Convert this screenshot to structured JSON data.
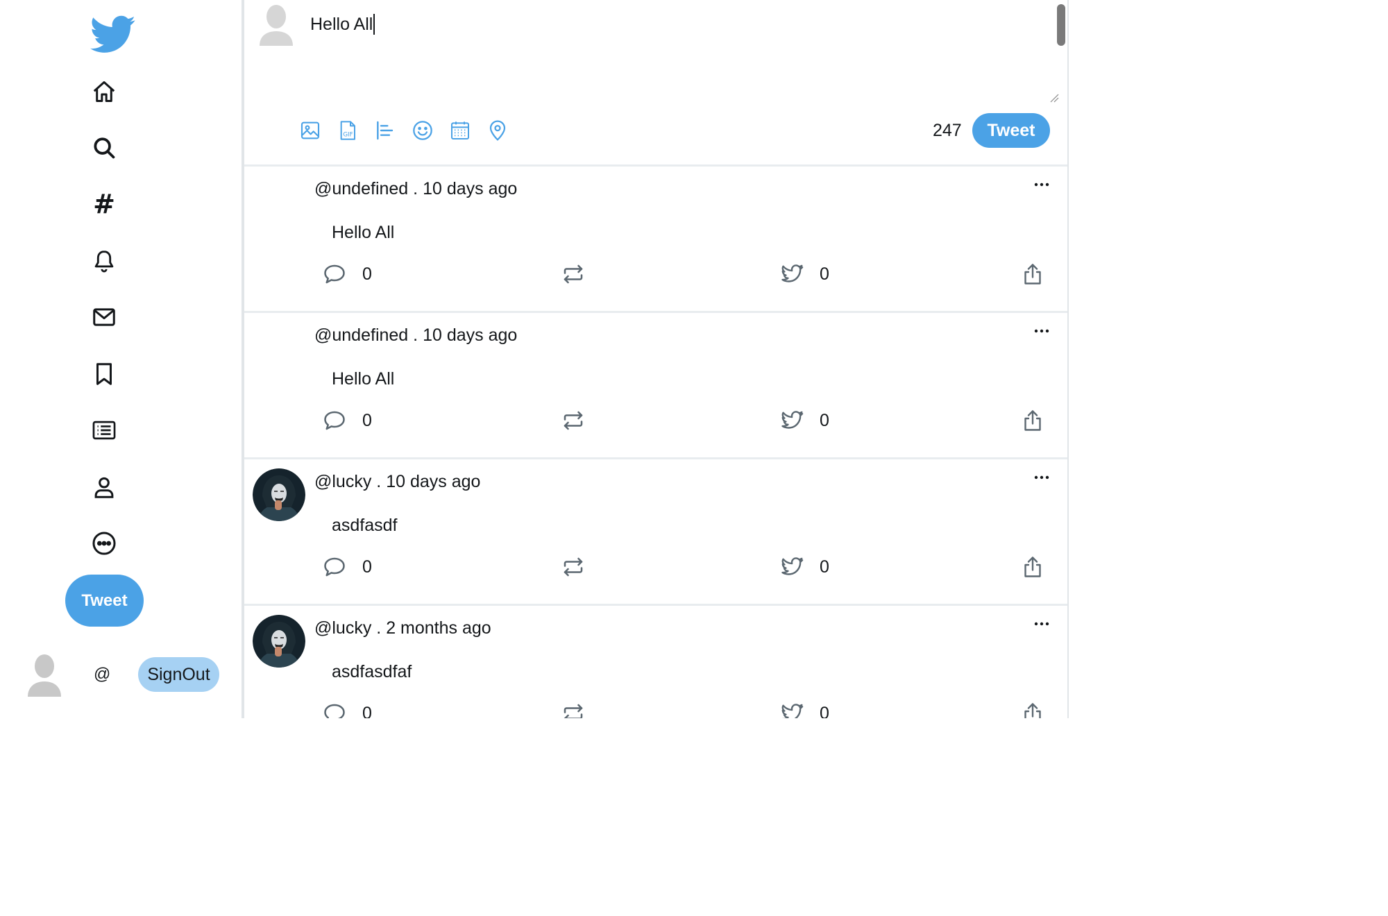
{
  "colors": {
    "accent": "#4ba2e6",
    "accent_light": "#a6d1f3",
    "text": "#14171a",
    "icon_grey": "#5b6770",
    "divider": "#e8ecef"
  },
  "sidebar": {
    "logo": "twitter-bird-icon",
    "nav": [
      "home-icon",
      "search-icon",
      "hashtag-icon",
      "bell-icon",
      "mail-icon",
      "bookmark-icon",
      "list-icon",
      "profile-icon",
      "more-circle-icon"
    ],
    "hashtag_glyph": "#",
    "tweet_label": "Tweet",
    "at_label": "@",
    "signout_label": "SignOut"
  },
  "compose": {
    "text": "Hello All",
    "tools": [
      "image-icon",
      "gif-icon",
      "poll-icon",
      "emoji-icon",
      "schedule-icon",
      "location-icon"
    ],
    "char_count": "247",
    "tweet_label": "Tweet"
  },
  "tweets": [
    {
      "handle": "@undefined",
      "sep": " . ",
      "time": "10 days ago",
      "body": "Hello All",
      "replies": "0",
      "likes": "0",
      "has_avatar": false
    },
    {
      "handle": "@undefined",
      "sep": " . ",
      "time": "10 days ago",
      "body": "Hello All",
      "replies": "0",
      "likes": "0",
      "has_avatar": false
    },
    {
      "handle": "@lucky",
      "sep": " . ",
      "time": "10 days ago",
      "body": "asdfasdf",
      "replies": "0",
      "likes": "0",
      "has_avatar": true
    },
    {
      "handle": "@lucky",
      "sep": " . ",
      "time": "2 months ago",
      "body": "asdfasdfaf",
      "replies": "0",
      "likes": "0",
      "has_avatar": true
    }
  ]
}
